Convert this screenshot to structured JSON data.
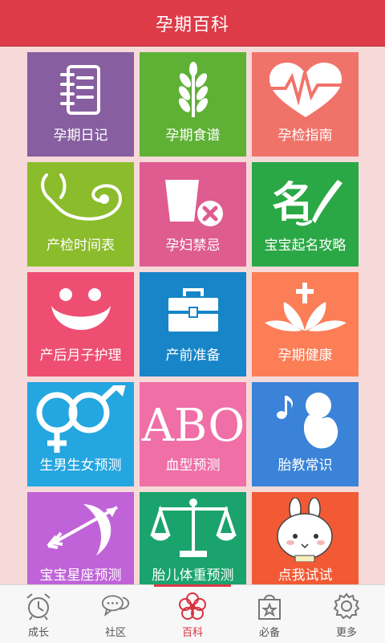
{
  "header": {
    "title": "孕期百科"
  },
  "tiles": [
    {
      "label": "孕期日记",
      "color": "#875ea0",
      "icon": "notebook-icon"
    },
    {
      "label": "孕期食谱",
      "color": "#5fb136",
      "icon": "wheat-icon"
    },
    {
      "label": "孕检指南",
      "color": "#f0736a",
      "icon": "heartbeat-icon"
    },
    {
      "label": "产检时间表",
      "color": "#8bbc2b",
      "icon": "stethoscope-icon"
    },
    {
      "label": "孕妇禁忌",
      "color": "#de5c8f",
      "icon": "forbidden-cup-icon"
    },
    {
      "label": "宝宝起名攻略",
      "color": "#2aa845",
      "icon": "brush-name-icon"
    },
    {
      "label": "产后月子护理",
      "color": "#ee4e72",
      "icon": "smile-icon"
    },
    {
      "label": "产前准备",
      "color": "#1785c8",
      "icon": "toolbox-icon"
    },
    {
      "label": "孕期健康",
      "color": "#fb7e57",
      "icon": "lotus-cross-icon"
    },
    {
      "label": "生男生女预测",
      "color": "#24a6e0",
      "icon": "gender-icon"
    },
    {
      "label": "血型预测",
      "color": "#ef6fa6",
      "icon": "abo-icon"
    },
    {
      "label": "胎教常识",
      "color": "#3a83d8",
      "icon": "fetus-music-icon"
    },
    {
      "label": "宝宝星座预测",
      "color": "#c063d8",
      "icon": "sagittarius-icon"
    },
    {
      "label": "胎儿体重预测",
      "color": "#1aa36c",
      "icon": "scale-icon"
    },
    {
      "label": "点我试试",
      "color": "#f25a35",
      "icon": "bunny-icon"
    }
  ],
  "abo_text": "ABO",
  "tabbar": [
    {
      "label": "成长",
      "icon": "alarm-clock-icon",
      "active": false
    },
    {
      "label": "社区",
      "icon": "chat-bubbles-icon",
      "active": false
    },
    {
      "label": "百科",
      "icon": "flower-icon",
      "active": true
    },
    {
      "label": "必备",
      "icon": "shopping-bag-icon",
      "active": false
    },
    {
      "label": "更多",
      "icon": "gear-icon",
      "active": false
    }
  ],
  "colors": {
    "header": "#dc3b47",
    "active_tab": "#d8323f",
    "background": "#f6d9d9"
  }
}
